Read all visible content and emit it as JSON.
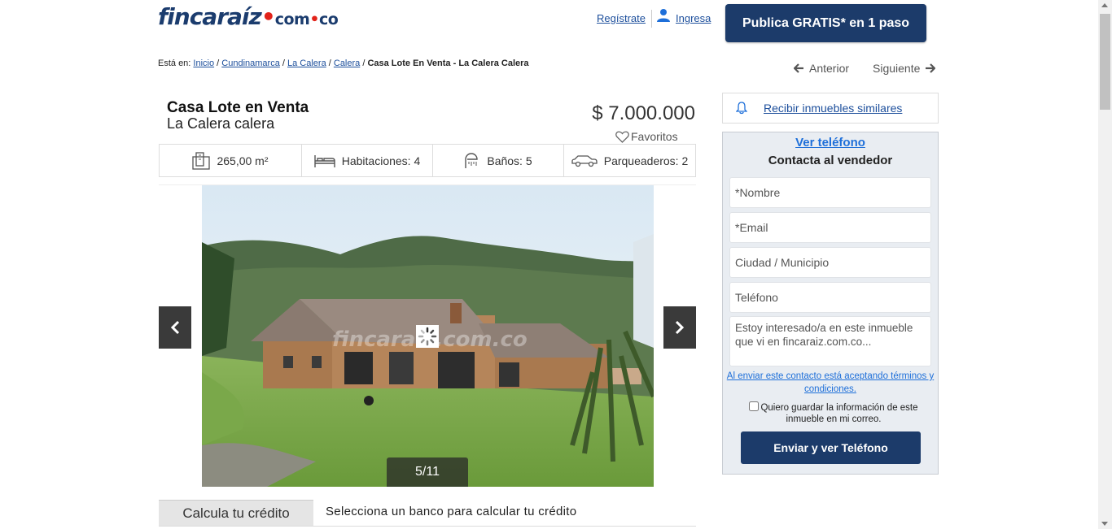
{
  "header": {
    "logo_main": "fincaraíz",
    "logo_com": "com",
    "logo_co": "co",
    "register_label": "Regístrate",
    "login_label": "Ingresa",
    "publish_label": "Publica GRATIS* en 1 paso"
  },
  "breadcrumb": {
    "prefix": "Está en:",
    "items": [
      "Inicio",
      "Cundinamarca",
      "La Calera",
      "Calera"
    ],
    "current": "Casa Lote En Venta - La Calera Calera"
  },
  "pager": {
    "prev": "Anterior",
    "next": "Siguiente"
  },
  "listing": {
    "title": "Casa Lote en Venta",
    "location": "La Calera calera",
    "price": "$ 7.000.000",
    "favorites": "Favoritos"
  },
  "features": {
    "area": "265,00 m²",
    "rooms": "Habitaciones: 4",
    "baths": "Baños: 5",
    "parking": "Parqueaderos: 2"
  },
  "gallery": {
    "counter": "5/11",
    "watermark": "fincaraíz.com.co"
  },
  "credit": {
    "tab_label": "Calcula tu crédito",
    "hint": "Selecciona un banco para calcular tu crédito"
  },
  "similar": {
    "label": "Recibir inmuebles similares"
  },
  "contact": {
    "view_phone": "Ver teléfono",
    "heading": "Contacta al vendedor",
    "name_placeholder": "*Nombre",
    "email_placeholder": "*Email",
    "city_placeholder": "Ciudad / Municipio",
    "phone_placeholder": "Teléfono",
    "message_placeholder": "Estoy interesado/a en este inmueble que vi en fincaraiz.com.co...",
    "terms": "Al enviar este contacto está aceptando términos y condiciones.",
    "save_label": "Quiero guardar la información de este inmueble en mi correo.",
    "send_label": "Enviar y ver Teléfono"
  },
  "colors": {
    "brand_navy": "#1c3b6a",
    "link_blue": "#1d4f9c",
    "accent_red": "#e2231a",
    "panel_bg": "#e9edf2"
  }
}
